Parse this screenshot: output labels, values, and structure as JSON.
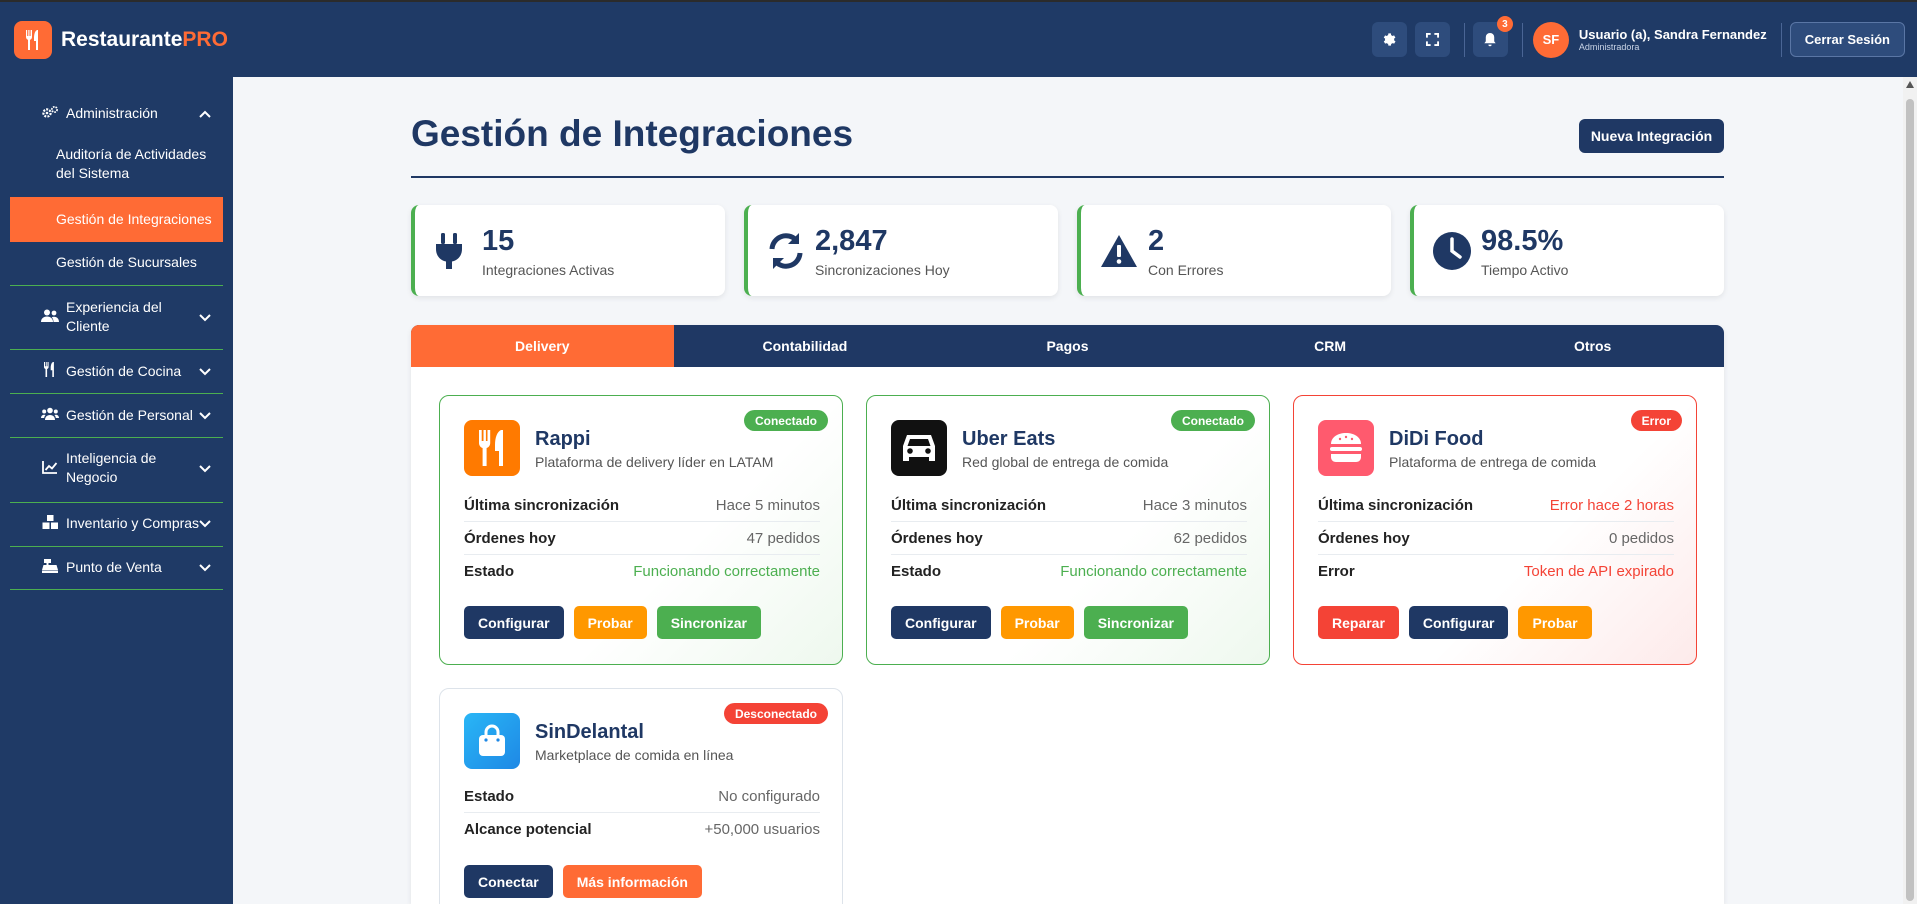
{
  "header": {
    "brand_main": "Restaurante",
    "brand_accent": "PRO",
    "notification_count": "3",
    "user_initials": "SF",
    "user_name": "Usuario (a), Sandra Fernandez",
    "user_role": "Administradora",
    "logout_label": "Cerrar Sesión"
  },
  "sidebar": {
    "admin": {
      "label": "Administración",
      "icon": "gears-icon"
    },
    "admin_items": [
      {
        "label": "Auditoría de Actividades del Sistema",
        "active": false
      },
      {
        "label": "Gestión de Integraciones",
        "active": true
      },
      {
        "label": "Gestión de Sucursales",
        "active": false
      }
    ],
    "sections": [
      {
        "label": "Experiencia del Cliente",
        "icon": "users-icon"
      },
      {
        "label": "Gestión de Cocina",
        "icon": "utensils-icon"
      },
      {
        "label": "Gestión de Personal",
        "icon": "team-icon"
      },
      {
        "label": "Inteligencia de Negocio",
        "icon": "chart-line-icon"
      },
      {
        "label": "Inventario y Compras",
        "icon": "boxes-icon"
      },
      {
        "label": "Punto de Venta",
        "icon": "cash-register-icon"
      }
    ]
  },
  "main": {
    "title": "Gestión de Integraciones",
    "new_button": "Nueva Integración",
    "stats": [
      {
        "value": "15",
        "label": "Integraciones Activas",
        "icon": "plug-icon"
      },
      {
        "value": "2,847",
        "label": "Sincronizaciones Hoy",
        "icon": "sync-icon"
      },
      {
        "value": "2",
        "label": "Con Errores",
        "icon": "warning-icon"
      },
      {
        "value": "98.5%",
        "label": "Tiempo Activo",
        "icon": "clock-icon"
      }
    ],
    "tabs": [
      "Delivery",
      "Contabilidad",
      "Pagos",
      "CRM",
      "Otros"
    ],
    "active_tab": "Delivery",
    "cards": [
      {
        "name": "Rappi",
        "description": "Plataforma de delivery líder en LATAM",
        "status": "Conectado",
        "rows": [
          {
            "key": "Última sincronización",
            "value": "Hace 5 minutos"
          },
          {
            "key": "Órdenes hoy",
            "value": "47 pedidos"
          },
          {
            "key": "Estado",
            "value": "Funcionando correctamente"
          }
        ],
        "buttons": [
          "Configurar",
          "Probar",
          "Sincronizar"
        ]
      },
      {
        "name": "Uber Eats",
        "description": "Red global de entrega de comida",
        "status": "Conectado",
        "rows": [
          {
            "key": "Última sincronización",
            "value": "Hace 3 minutos"
          },
          {
            "key": "Órdenes hoy",
            "value": "62 pedidos"
          },
          {
            "key": "Estado",
            "value": "Funcionando correctamente"
          }
        ],
        "buttons": [
          "Configurar",
          "Probar",
          "Sincronizar"
        ]
      },
      {
        "name": "DiDi Food",
        "description": "Plataforma de entrega de comida",
        "status": "Error",
        "rows": [
          {
            "key": "Última sincronización",
            "value": "Error hace 2 horas"
          },
          {
            "key": "Órdenes hoy",
            "value": "0 pedidos"
          },
          {
            "key": "Error",
            "value": "Token de API expirado"
          }
        ],
        "buttons": [
          "Reparar",
          "Configurar",
          "Probar"
        ]
      },
      {
        "name": "SinDelantal",
        "description": "Marketplace de comida en línea",
        "status": "Desconectado",
        "rows": [
          {
            "key": "Estado",
            "value": "No configurado"
          },
          {
            "key": "Alcance potencial",
            "value": "+50,000 usuarios"
          }
        ],
        "buttons": [
          "Conectar",
          "Más información"
        ]
      }
    ]
  },
  "colors": {
    "navy": "#1f3864",
    "orange": "#ff6b35",
    "green": "#4caf50",
    "red": "#f44336",
    "amber": "#ff9800"
  }
}
